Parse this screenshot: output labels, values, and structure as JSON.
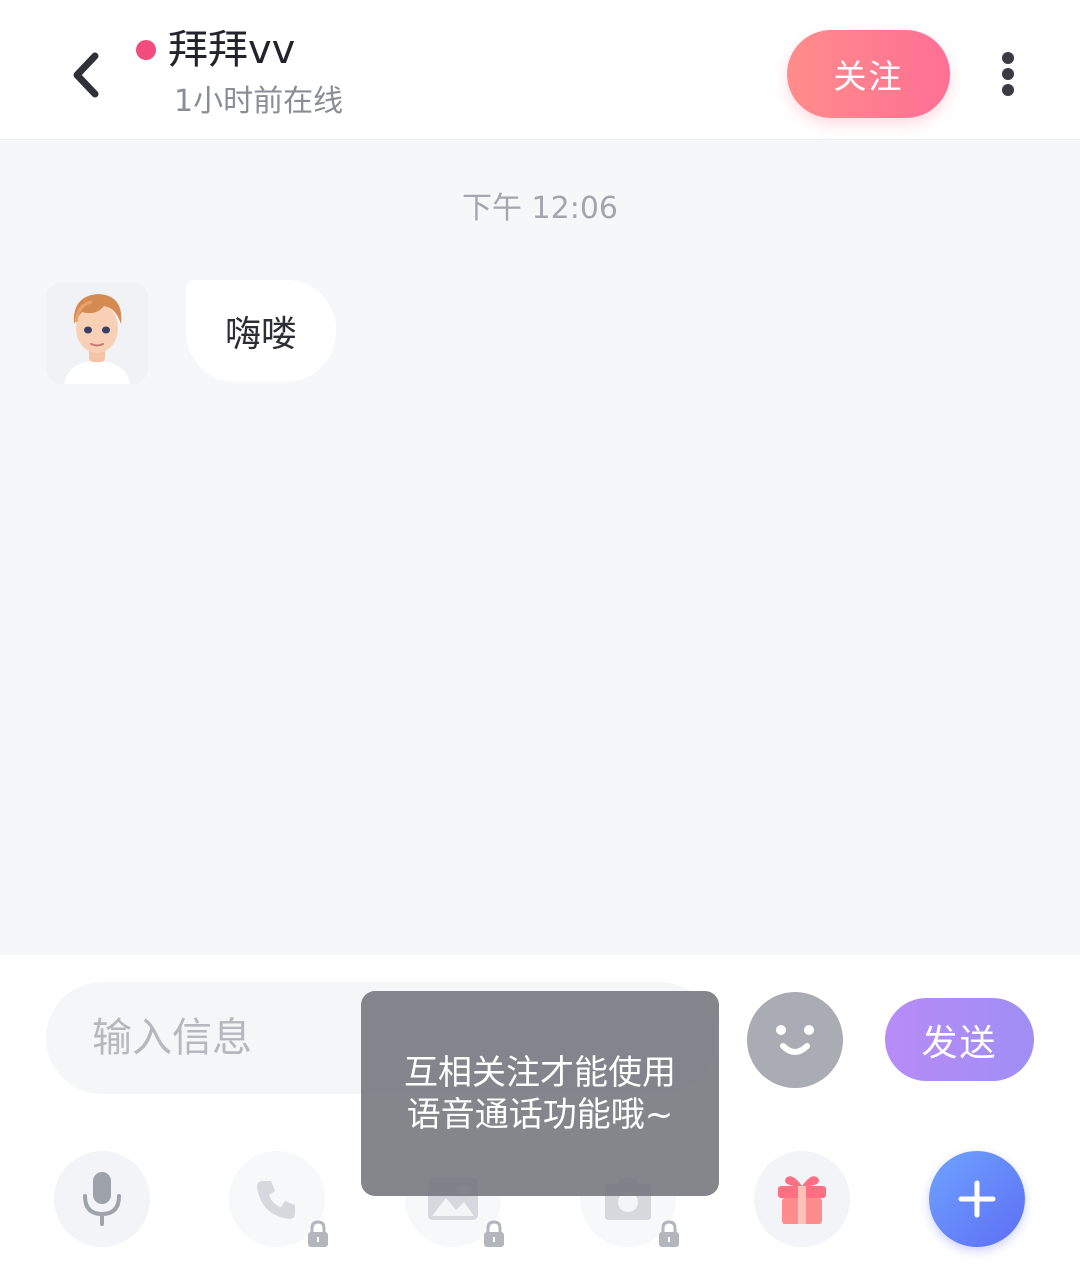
{
  "header": {
    "contact_name": "拜拜vv",
    "status_text": "1小时前在线",
    "follow_label": "关注",
    "online_color": "#f44b7e"
  },
  "chat": {
    "timestamp": "下午 12:06",
    "messages": [
      {
        "sender": "other",
        "text": "嗨喽"
      }
    ]
  },
  "composer": {
    "placeholder": "输入信息",
    "send_label": "发送"
  },
  "toolbar": {
    "items": [
      {
        "icon": "microphone-icon",
        "locked": false
      },
      {
        "icon": "phone-icon",
        "locked": true
      },
      {
        "icon": "image-icon",
        "locked": true
      },
      {
        "icon": "camera-icon",
        "locked": true
      },
      {
        "icon": "gift-icon",
        "locked": false
      },
      {
        "icon": "plus-icon",
        "locked": false
      }
    ]
  },
  "toast": {
    "text": "互相关注才能使用语音通话功能哦~"
  },
  "colors": {
    "follow_gradient": [
      "#ff8d8a",
      "#ff6f95"
    ],
    "send_gradient": [
      "#b88cf7",
      "#9f8ef5"
    ],
    "plus_gradient": [
      "#6ea3ff",
      "#5e6ef5"
    ]
  }
}
